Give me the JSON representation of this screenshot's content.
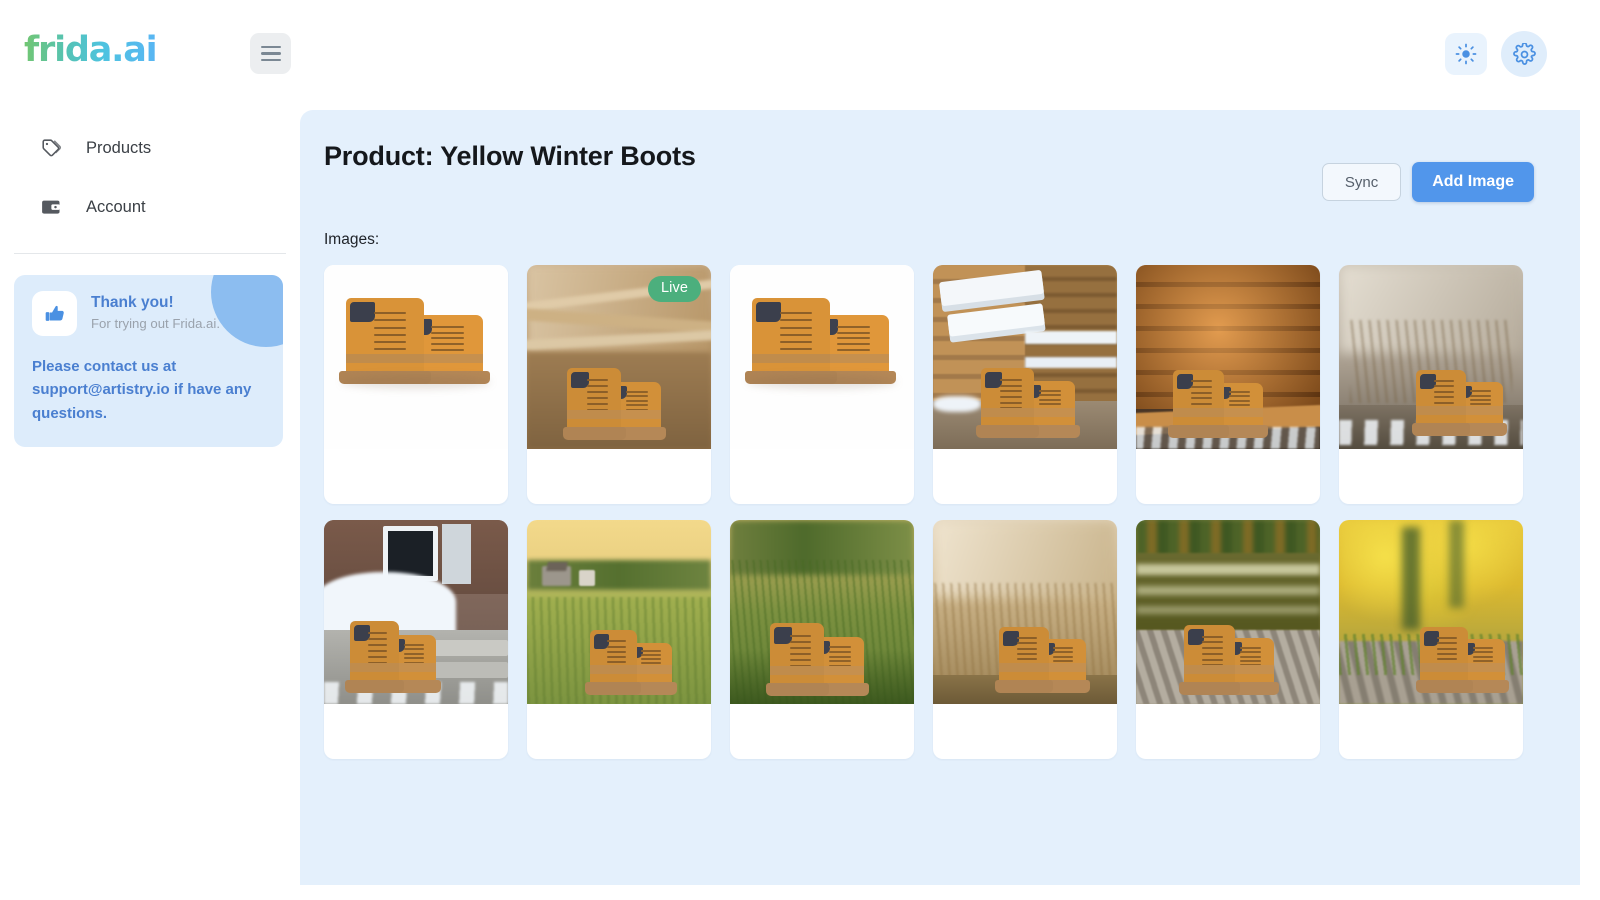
{
  "brand": {
    "logo_text": "frida.ai"
  },
  "topbar": {
    "menu_icon": "hamburger-icon",
    "brightness_icon": "sun-icon",
    "settings_icon": "gear-icon"
  },
  "sidebar": {
    "items": [
      {
        "label": "Products",
        "icon": "tags-icon"
      },
      {
        "label": "Account",
        "icon": "wallet-icon"
      }
    ],
    "promo": {
      "icon": "thumbs-up-icon",
      "title": "Thank you!",
      "subtitle": "For trying out Frida.ai.",
      "body": "Please contact us at support@artistry.io if have any questions."
    }
  },
  "main": {
    "title": "Product: Yellow Winter Boots",
    "sync_label": "Sync",
    "add_image_label": "Add Image",
    "images_label": "Images:",
    "live_badge": "Live",
    "images": [
      {
        "id": 1,
        "scene": "studio-white",
        "live": false,
        "alt": "Yellow winter boots on white studio background"
      },
      {
        "id": 2,
        "scene": "lumber-yard",
        "live": true,
        "alt": "Yellow winter boots on dirt at a lumber yard"
      },
      {
        "id": 3,
        "scene": "studio-white",
        "live": false,
        "alt": "Yellow winter boots on white studio background"
      },
      {
        "id": 4,
        "scene": "log-cabin-snow",
        "live": false,
        "alt": "Yellow winter boots on a snowy log cabin porch"
      },
      {
        "id": 5,
        "scene": "log-wall",
        "live": false,
        "alt": "Yellow winter boots against an orange log wall"
      },
      {
        "id": 6,
        "scene": "misty-field",
        "live": false,
        "alt": "Yellow winter boots in a misty snowy field"
      },
      {
        "id": 7,
        "scene": "snowy-steps",
        "live": false,
        "alt": "Yellow winter boots on snowy stone steps"
      },
      {
        "id": 8,
        "scene": "golden-meadow",
        "live": false,
        "alt": "Yellow winter boots in a golden meadow at sunset"
      },
      {
        "id": 9,
        "scene": "tall-grass",
        "live": false,
        "alt": "Yellow winter boots in tall green grass"
      },
      {
        "id": 10,
        "scene": "sepia-field",
        "live": false,
        "alt": "Yellow winter boots in a sepia dry field"
      },
      {
        "id": 11,
        "scene": "lakeside",
        "live": false,
        "alt": "Yellow winter boots on rocks by an autumn lake"
      },
      {
        "id": 12,
        "scene": "autumn-yellow",
        "live": false,
        "alt": "Yellow winter boots before bright yellow autumn foliage"
      }
    ]
  },
  "colors": {
    "accent_blue": "#5196eb",
    "panel_bg": "#e4f0fc",
    "live_green": "#4caf7d",
    "promo_bg": "#ddecfb",
    "promo_text": "#4a7fd0"
  }
}
